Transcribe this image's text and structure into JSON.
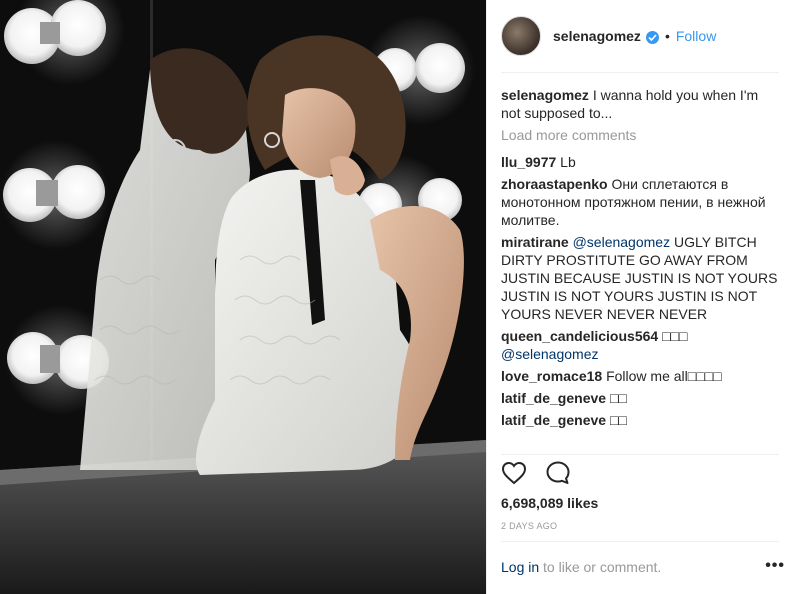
{
  "post": {
    "username": "selenagomez",
    "verified": true,
    "follow_label": "Follow",
    "dot": "•",
    "caption": {
      "user": "selenagomez",
      "text": "I wanna hold you when I'm not supposed to..."
    },
    "load_more": "Load more comments",
    "comments": [
      {
        "user": "llu_9977",
        "text": "Lb"
      },
      {
        "user": "zhoraastapenko",
        "text": "Они сплетаются в монотонном протяжном пении, в нежной молитве."
      },
      {
        "user": "miratirane",
        "mention": "@selenagomez",
        "text": "UGLY BITCH DIRTY PROSTITUTE GO AWAY FROM JUSTIN BECAUSE JUSTIN IS NOT YOURS JUSTIN IS NOT YOURS JUSTIN IS NOT YOURS NEVER NEVER NEVER"
      },
      {
        "user": "queen_candelicious564",
        "text": "□□□",
        "mention2": "@selenagomez"
      },
      {
        "user": "love_romace18",
        "text": "Follow me all□□□□"
      },
      {
        "user": "latif_de_geneve",
        "text": "□□"
      },
      {
        "user": "latif_de_geneve",
        "text": "□□"
      }
    ],
    "likes": "6,698,089 likes",
    "time": "2 DAYS AGO",
    "footer": {
      "login": "Log in",
      "rest": "to like or comment."
    },
    "more": "•••"
  },
  "icons": {
    "like": "heart-icon",
    "comment": "comment-icon",
    "verified": "verified-badge-icon",
    "more": "more-options-icon"
  },
  "colors": {
    "link_blue": "#3897f0",
    "mention": "#003569",
    "muted": "#999999",
    "text": "#262626"
  }
}
